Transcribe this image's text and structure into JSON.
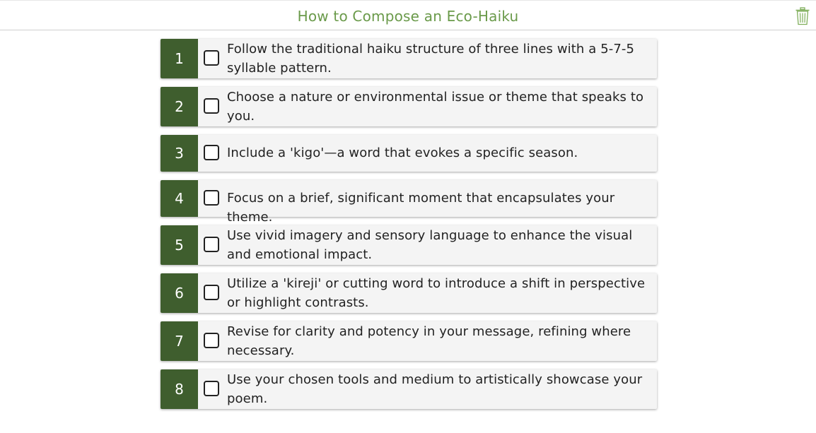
{
  "header": {
    "title": "How to Compose an Eco-Haiku",
    "trash_icon": "trash-icon"
  },
  "colors": {
    "accent": "#6a9a4a",
    "number_block": "#3f5e2e",
    "card": "#f4f4f4"
  },
  "steps": [
    {
      "number": "1",
      "text": "Follow the traditional haiku structure of three lines with a 5-7-5 syllable pattern.",
      "checked": false
    },
    {
      "number": "2",
      "text": "Choose a nature or environmental issue or theme that speaks to you.",
      "checked": false
    },
    {
      "number": "3",
      "text": "Include a 'kigo'—a word that evokes a specific season.",
      "checked": false
    },
    {
      "number": "4",
      "text": "Focus on a brief, significant moment that encapsulates your theme.",
      "checked": false
    },
    {
      "number": "5",
      "text": "Use vivid imagery and sensory language to enhance the visual and emotional impact.",
      "checked": false
    },
    {
      "number": "6",
      "text": "Utilize a 'kireji' or cutting word to introduce a shift in perspective or highlight contrasts.",
      "checked": false
    },
    {
      "number": "7",
      "text": "Revise for clarity and potency in your message, refining where necessary.",
      "checked": false
    },
    {
      "number": "8",
      "text": "Use your chosen tools and medium to artistically showcase your poem.",
      "checked": false
    }
  ]
}
